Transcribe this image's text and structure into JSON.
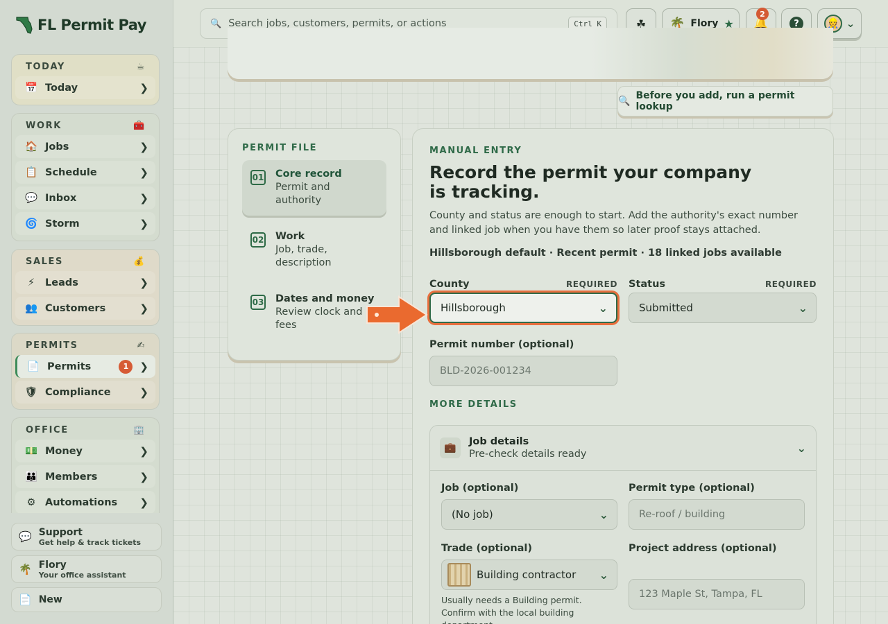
{
  "brand": {
    "name": "FL Permit Pay"
  },
  "sidebar": {
    "groups": [
      {
        "title": "TODAY",
        "items": [
          {
            "label": "Today"
          }
        ]
      },
      {
        "title": "WORK",
        "items": [
          {
            "label": "Jobs"
          },
          {
            "label": "Schedule"
          },
          {
            "label": "Inbox"
          },
          {
            "label": "Storm"
          }
        ]
      },
      {
        "title": "SALES",
        "items": [
          {
            "label": "Leads"
          },
          {
            "label": "Customers"
          }
        ]
      },
      {
        "title": "PERMITS",
        "items": [
          {
            "label": "Permits",
            "badge": "1",
            "active": true
          },
          {
            "label": "Compliance"
          }
        ]
      },
      {
        "title": "OFFICE",
        "items": [
          {
            "label": "Money"
          },
          {
            "label": "Members"
          },
          {
            "label": "Automations"
          }
        ]
      }
    ],
    "support": {
      "title": "Support",
      "subtitle": "Get help & track tickets"
    },
    "assistant": {
      "title": "Flory",
      "subtitle": "Your office assistant"
    },
    "new_label": "New"
  },
  "topbar": {
    "search_placeholder": "Search jobs, customers, permits, or actions",
    "shortcut": "Ctrl K",
    "assistant_name": "Flory",
    "notifications_count": "2"
  },
  "lookup_button": "Before you add, run a permit lookup",
  "permit_file": {
    "eyebrow": "PERMIT FILE",
    "steps": [
      {
        "num": "01",
        "title": "Core record",
        "desc": "Permit and authority",
        "active": true
      },
      {
        "num": "02",
        "title": "Work",
        "desc": "Job, trade, description",
        "active": false
      },
      {
        "num": "03",
        "title": "Dates and money",
        "desc": "Review clock and fees",
        "active": false
      }
    ]
  },
  "form": {
    "eyebrow": "MANUAL ENTRY",
    "title": "Record the permit your company is tracking.",
    "description": "County and status are enough to start. Add the authority's exact number and linked job when you have them so later proof stays attached.",
    "meta": "Hillsborough default · Recent permit · 18 linked jobs available",
    "county": {
      "label": "County",
      "required": "REQUIRED",
      "value": "Hillsborough"
    },
    "status": {
      "label": "Status",
      "required": "REQUIRED",
      "value": "Submitted"
    },
    "permit_number": {
      "label": "Permit number (optional)",
      "placeholder": "BLD-2026-001234"
    },
    "more_details": "MORE DETAILS",
    "job_details": {
      "title": "Job details",
      "subtitle": "Pre-check details ready",
      "job": {
        "label": "Job (optional)",
        "value": "(No job)"
      },
      "permit_type": {
        "label": "Permit type (optional)",
        "placeholder": "Re-roof / building"
      },
      "trade": {
        "label": "Trade (optional)",
        "value": "Building contractor",
        "hint": "Usually needs a Building permit. Confirm with the local building department."
      },
      "project_address": {
        "label": "Project address (optional)",
        "placeholder": "123 Maple St, Tampa, FL"
      }
    }
  },
  "colors": {
    "accent": "#2f6a48",
    "highlight": "#e86f3e",
    "badge": "#d65b36"
  }
}
